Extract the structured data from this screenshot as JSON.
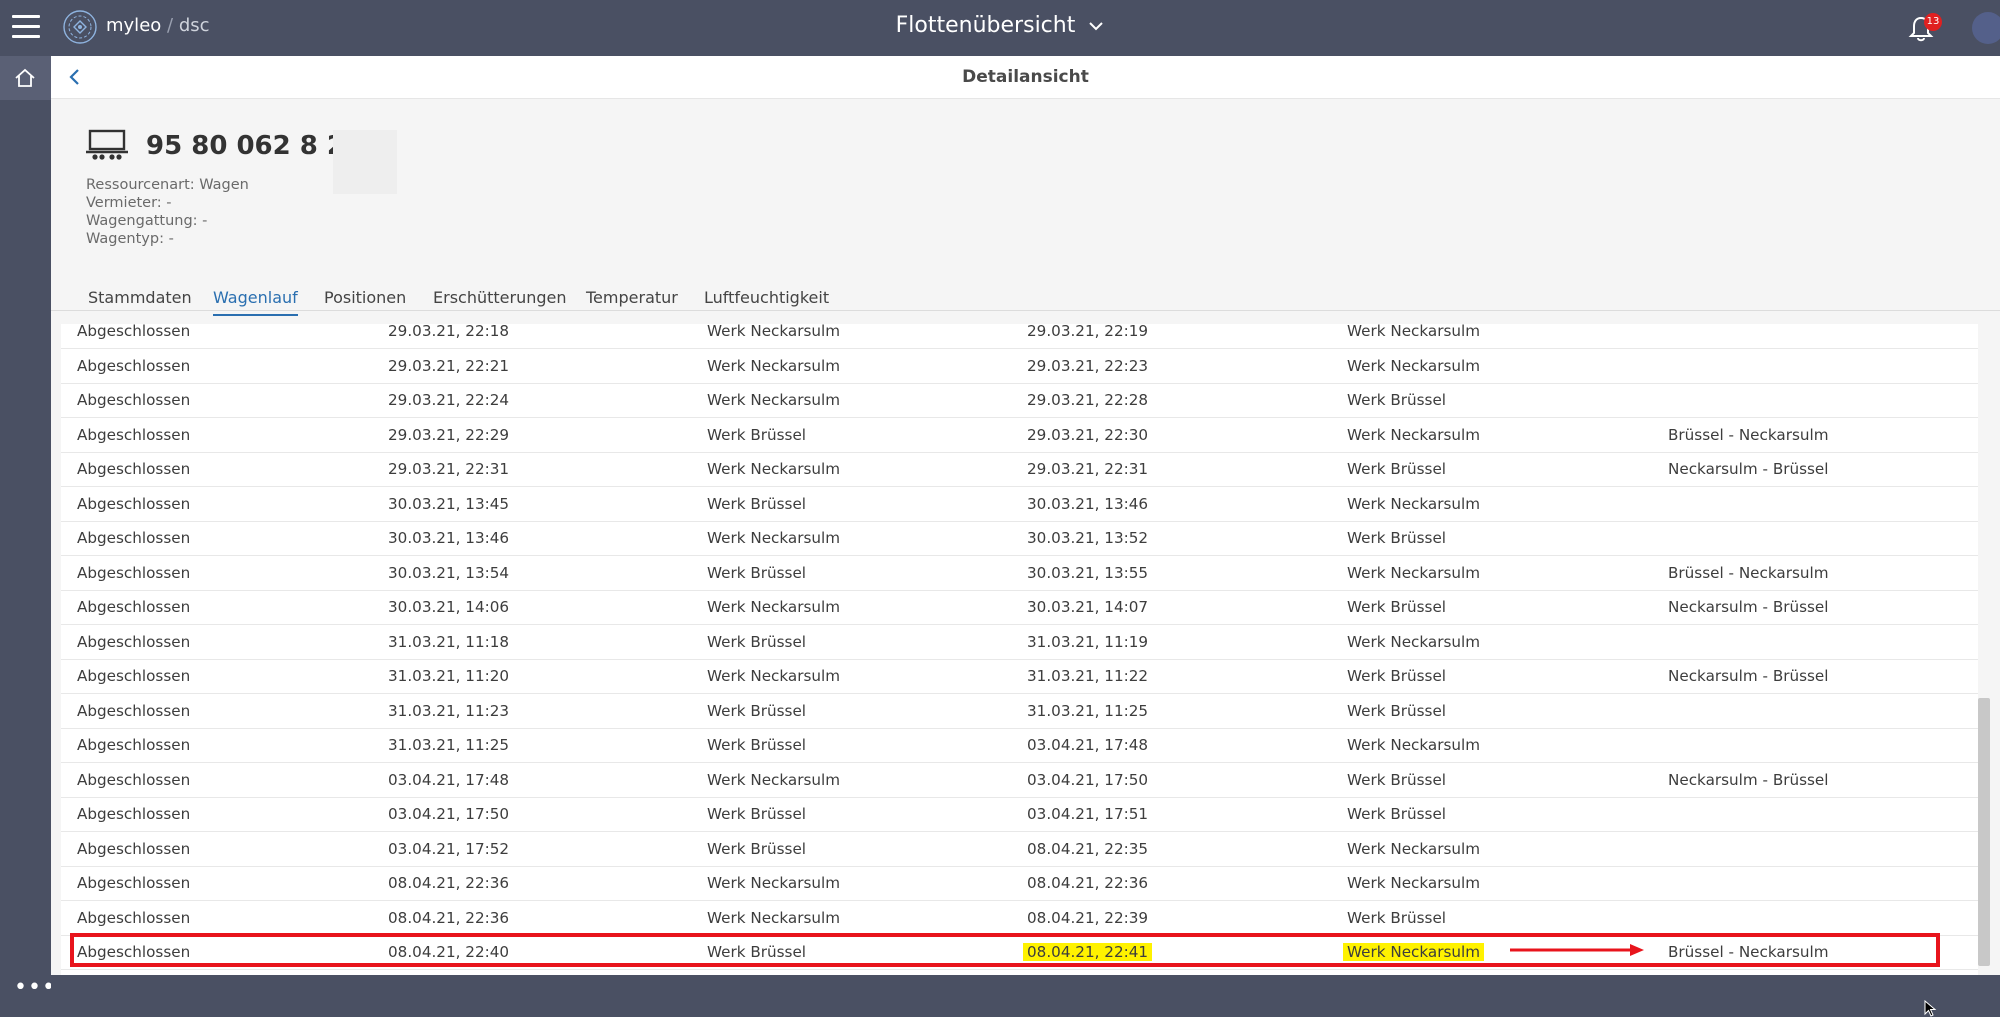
{
  "header": {
    "brand_name": "myleo",
    "brand_separator": "/",
    "brand_product": "dsc",
    "page_switch": "Flottenübersicht",
    "notification_count": "13"
  },
  "subheader": {
    "title": "Detailansicht"
  },
  "resource": {
    "title": "95 80 062 8 204",
    "meta": [
      "Ressourcenart: Wagen",
      "Vermieter: -",
      "Wagengattung: -",
      "Wagentyp: -"
    ]
  },
  "tabs": [
    "Stammdaten",
    "Wagenlauf",
    "Positionen",
    "Erschütterungen",
    "Temperatur",
    "Luftfeuchtigkeit"
  ],
  "active_tab": "Wagenlauf",
  "rows": [
    [
      "Abgeschlossen",
      "29.03.21, 22:18",
      "Werk Neckarsulm",
      "29.03.21, 22:19",
      "Werk Neckarsulm",
      ""
    ],
    [
      "Abgeschlossen",
      "29.03.21, 22:21",
      "Werk Neckarsulm",
      "29.03.21, 22:23",
      "Werk Neckarsulm",
      ""
    ],
    [
      "Abgeschlossen",
      "29.03.21, 22:24",
      "Werk Neckarsulm",
      "29.03.21, 22:28",
      "Werk Brüssel",
      ""
    ],
    [
      "Abgeschlossen",
      "29.03.21, 22:29",
      "Werk Brüssel",
      "29.03.21, 22:30",
      "Werk Neckarsulm",
      "Brüssel - Neckarsulm"
    ],
    [
      "Abgeschlossen",
      "29.03.21, 22:31",
      "Werk Neckarsulm",
      "29.03.21, 22:31",
      "Werk Brüssel",
      "Neckarsulm - Brüssel"
    ],
    [
      "Abgeschlossen",
      "30.03.21, 13:45",
      "Werk Brüssel",
      "30.03.21, 13:46",
      "Werk Neckarsulm",
      ""
    ],
    [
      "Abgeschlossen",
      "30.03.21, 13:46",
      "Werk Neckarsulm",
      "30.03.21, 13:52",
      "Werk Brüssel",
      ""
    ],
    [
      "Abgeschlossen",
      "30.03.21, 13:54",
      "Werk Brüssel",
      "30.03.21, 13:55",
      "Werk Neckarsulm",
      "Brüssel - Neckarsulm"
    ],
    [
      "Abgeschlossen",
      "30.03.21, 14:06",
      "Werk Neckarsulm",
      "30.03.21, 14:07",
      "Werk Brüssel",
      "Neckarsulm - Brüssel"
    ],
    [
      "Abgeschlossen",
      "31.03.21, 11:18",
      "Werk Brüssel",
      "31.03.21, 11:19",
      "Werk Neckarsulm",
      ""
    ],
    [
      "Abgeschlossen",
      "31.03.21, 11:20",
      "Werk Neckarsulm",
      "31.03.21, 11:22",
      "Werk Brüssel",
      "Neckarsulm - Brüssel"
    ],
    [
      "Abgeschlossen",
      "31.03.21, 11:23",
      "Werk Brüssel",
      "31.03.21, 11:25",
      "Werk Brüssel",
      ""
    ],
    [
      "Abgeschlossen",
      "31.03.21, 11:25",
      "Werk Brüssel",
      "03.04.21, 17:48",
      "Werk Neckarsulm",
      ""
    ],
    [
      "Abgeschlossen",
      "03.04.21, 17:48",
      "Werk Neckarsulm",
      "03.04.21, 17:50",
      "Werk Brüssel",
      "Neckarsulm - Brüssel"
    ],
    [
      "Abgeschlossen",
      "03.04.21, 17:50",
      "Werk Brüssel",
      "03.04.21, 17:51",
      "Werk Brüssel",
      ""
    ],
    [
      "Abgeschlossen",
      "03.04.21, 17:52",
      "Werk Brüssel",
      "08.04.21, 22:35",
      "Werk Neckarsulm",
      ""
    ],
    [
      "Abgeschlossen",
      "08.04.21, 22:36",
      "Werk Neckarsulm",
      "08.04.21, 22:36",
      "Werk Neckarsulm",
      ""
    ],
    [
      "Abgeschlossen",
      "08.04.21, 22:36",
      "Werk Neckarsulm",
      "08.04.21, 22:39",
      "Werk Brüssel",
      ""
    ],
    [
      "Abgeschlossen",
      "08.04.21, 22:40",
      "Werk Brüssel",
      "08.04.21, 22:41",
      "Werk Neckarsulm",
      "Brüssel - Neckarsulm"
    ]
  ],
  "highlighted_row": 18,
  "highlighted_cells": [
    3,
    4
  ],
  "colors": {
    "header_bg": "#4a5063",
    "accent": "#2a6fb0",
    "highlight": "#fff200",
    "annotation": "#e8141c"
  },
  "icons": {
    "menu": "hamburger-icon",
    "logo": "myleo-logo-icon",
    "dropdown": "chevron-down-icon",
    "notifications": "bell-icon",
    "home": "home-icon",
    "back": "chevron-left-icon",
    "resource": "wagon-icon",
    "more": "more-dots-icon"
  }
}
